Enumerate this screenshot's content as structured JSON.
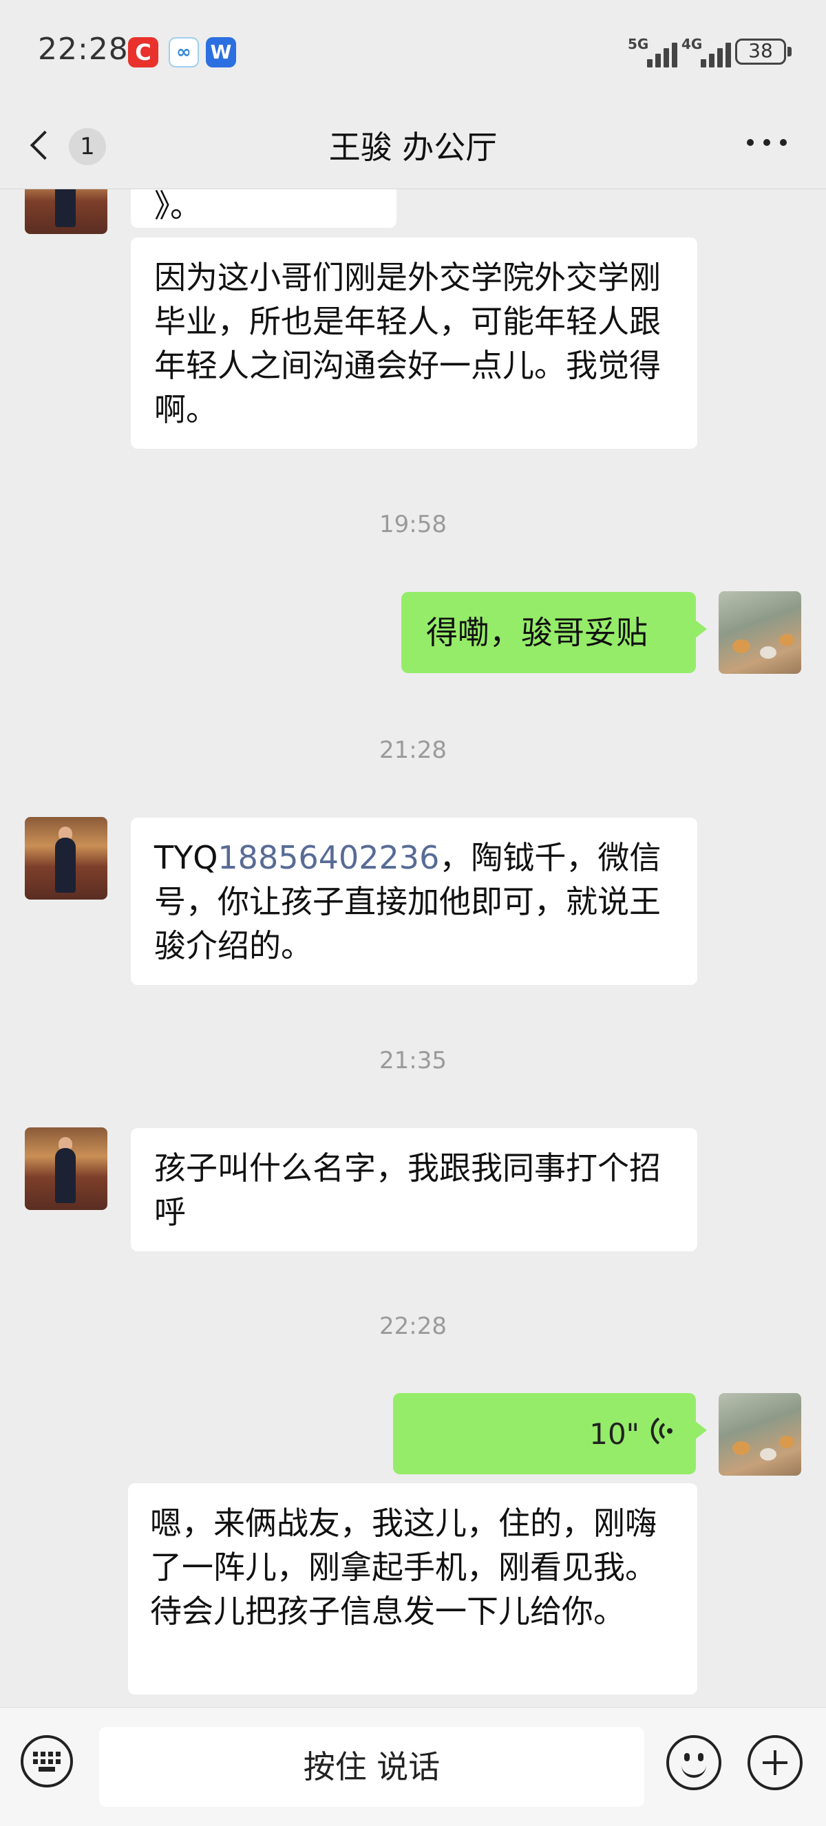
{
  "status_bar": {
    "time": "22:28",
    "app_icons": {
      "c": "C",
      "w": "W"
    },
    "signal_1": "5G",
    "signal_2": "4G",
    "battery": "38"
  },
  "nav": {
    "unread_count": "1",
    "title": "王骏 办公厅"
  },
  "messages": {
    "m0_partial": "》。",
    "m1": "因为这小哥们刚是外交学院外交学刚毕业，所也是年轻人，可能年轻人跟年轻人之间沟通会好一点儿。我觉得啊。",
    "ts1": "19:58",
    "m2": "得嘞，骏哥妥贴",
    "ts2": "21:28",
    "m3_prefix": "TYQ",
    "m3_link": "18856402236",
    "m3_suffix": "，陶钺千，微信号，你让孩子直接加他即可，就说王骏介绍的。",
    "ts3": "21:35",
    "m4": "孩子叫什么名字，我跟我同事打个招呼",
    "ts4": "22:28",
    "m5_voice_duration": "10\"",
    "m6": "嗯，来俩战友，我这儿，住的，刚嗨了一阵儿，刚拿起手机，刚看见我。待会儿把孩子信息发一下儿给你。"
  },
  "input_bar": {
    "hold_to_talk": "按住 说话"
  },
  "colors": {
    "background": "#ededed",
    "outgoing_bubble": "#95ec69",
    "incoming_bubble": "#ffffff",
    "link": "#576b95"
  }
}
